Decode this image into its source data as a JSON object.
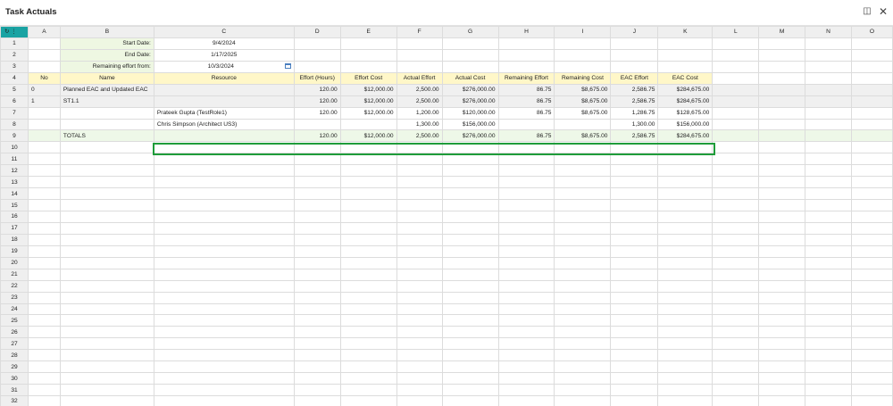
{
  "window": {
    "title": "Task Actuals"
  },
  "columns": [
    "A",
    "B",
    "C",
    "D",
    "E",
    "F",
    "G",
    "H",
    "I",
    "J",
    "K",
    "L",
    "M",
    "N",
    "O"
  ],
  "rows": [
    "1",
    "2",
    "3",
    "4",
    "5",
    "6",
    "7",
    "8",
    "9",
    "10",
    "11",
    "12",
    "13",
    "14",
    "15",
    "16",
    "17",
    "18",
    "19",
    "20",
    "21",
    "22",
    "23",
    "24",
    "25",
    "26",
    "27",
    "28",
    "29",
    "30",
    "31",
    "32"
  ],
  "params": {
    "start_label": "Start Date:",
    "start_value": "9/4/2024",
    "end_label": "End Date:",
    "end_value": "1/17/2025",
    "remaining_label": "Remaining effort from:",
    "remaining_value": "10/3/2024"
  },
  "headers": {
    "no": "No",
    "name": "Name",
    "resource": "Resource",
    "effort": "Effort (Hours)",
    "effort_cost": "Effort Cost",
    "actual_effort": "Actual Effort",
    "actual_cost": "Actual Cost",
    "remaining_effort": "Remaining Effort",
    "remaining_cost": "Remaining Cost",
    "eac_effort": "EAC Effort",
    "eac_cost": "EAC Cost"
  },
  "data_rows": [
    {
      "no": "0",
      "name": "Planned EAC and Updated EAC",
      "resource": "",
      "effort": "120.00",
      "effort_cost": "$12,000.00",
      "actual_effort": "2,500.00",
      "actual_cost": "$276,000.00",
      "remaining_effort": "86.75",
      "remaining_cost": "$8,675.00",
      "eac_effort": "2,586.75",
      "eac_cost": "$284,675.00"
    },
    {
      "no": "1",
      "name": "ST1.1",
      "resource": "",
      "effort": "120.00",
      "effort_cost": "$12,000.00",
      "actual_effort": "2,500.00",
      "actual_cost": "$276,000.00",
      "remaining_effort": "86.75",
      "remaining_cost": "$8,675.00",
      "eac_effort": "2,586.75",
      "eac_cost": "$284,675.00"
    },
    {
      "no": "",
      "name": "",
      "resource": "Prateek Gupta (TestRole1)",
      "effort": "120.00",
      "effort_cost": "$12,000.00",
      "actual_effort": "1,200.00",
      "actual_cost": "$120,000.00",
      "remaining_effort": "86.75",
      "remaining_cost": "$8,675.00",
      "eac_effort": "1,286.75",
      "eac_cost": "$128,675.00"
    },
    {
      "no": "",
      "name": "",
      "resource": "Chris Simpson (Architect US3)",
      "effort": "",
      "effort_cost": "",
      "actual_effort": "1,300.00",
      "actual_cost": "$156,000.00",
      "remaining_effort": "",
      "remaining_cost": "",
      "eac_effort": "1,300.00",
      "eac_cost": "$156,000.00"
    }
  ],
  "totals": {
    "label": "TOTALS",
    "effort": "120.00",
    "effort_cost": "$12,000.00",
    "actual_effort": "2,500.00",
    "actual_cost": "$276,000.00",
    "remaining_effort": "86.75",
    "remaining_cost": "$8,675.00",
    "eac_effort": "2,586.75",
    "eac_cost": "$284,675.00"
  },
  "colors": {
    "accent": "#1aa3a3",
    "selection": "#1f9c3a",
    "header_yellow": "#fff7c8",
    "label_green": "#eef7e2"
  }
}
